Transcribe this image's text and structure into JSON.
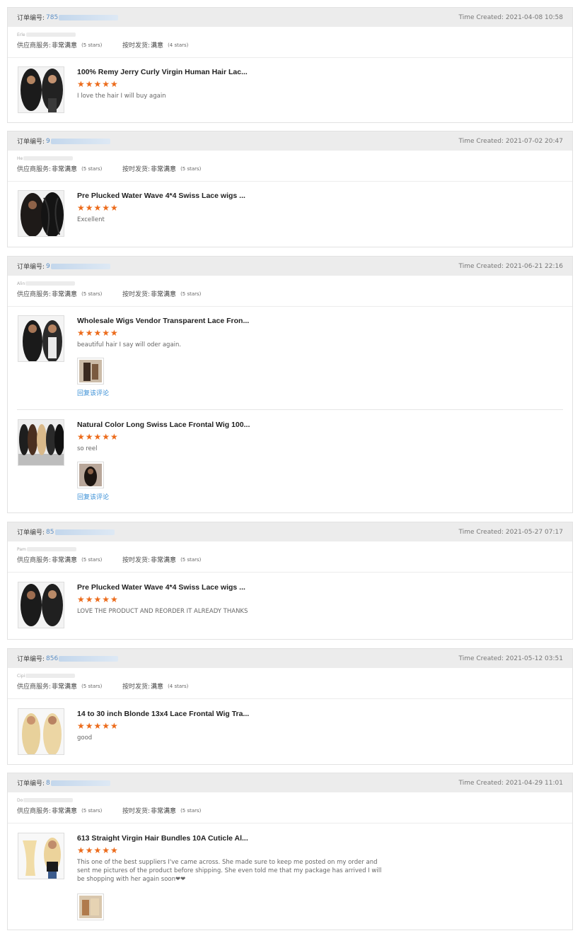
{
  "labels": {
    "order_no": "订单编号:",
    "supplier_service": "供应商服务:",
    "on_time_shipping": "按时发货:",
    "reply": "回复该评论"
  },
  "colors": {
    "star": "#ec6b1b",
    "link": "#3a8fd6",
    "header_bg": "#ececec"
  },
  "orders": [
    {
      "order_prefix": "785",
      "time": "Time Created: 2021-04-08 10:58",
      "buyer": "Erle",
      "service": "非常满意",
      "service_stars": "(5 stars)",
      "shipping": "满意",
      "shipping_stars": "(4 stars)",
      "items": [
        {
          "title": "100% Remy Jerry Curly Virgin Human Hair Lac...",
          "stars": "★★★★★",
          "comment": "I love the hair I will buy again",
          "image": "curly-wig"
        }
      ]
    },
    {
      "order_prefix": "9",
      "time": "Time Created: 2021-07-02 20:47",
      "buyer": "He",
      "service": "非常满意",
      "service_stars": "(5 stars)",
      "shipping": "非常满意",
      "shipping_stars": "(5 stars)",
      "items": [
        {
          "title": "Pre Plucked Water Wave 4*4 Swiss Lace wigs ...",
          "stars": "★★★★★",
          "comment": "Excellent",
          "image": "water-wave-wig"
        }
      ]
    },
    {
      "order_prefix": "9",
      "time": "Time Created: 2021-06-21 22:16",
      "buyer": "Alin",
      "service": "非常满意",
      "service_stars": "(5 stars)",
      "shipping": "非常满意",
      "shipping_stars": "(5 stars)",
      "items": [
        {
          "title": "Wholesale Wigs Vendor Transparent Lace Fron...",
          "stars": "★★★★★",
          "comment": "beautiful hair I say will oder again.",
          "image": "lace-front-wig",
          "photo": "review-photo"
        },
        {
          "title": "Natural Color Long Swiss Lace Frontal Wig 100...",
          "stars": "★★★★★",
          "comment": "so reel",
          "image": "color-wigs",
          "photo": "review-photo"
        }
      ]
    },
    {
      "order_prefix": "85",
      "time": "Time Created: 2021-05-27 07:17",
      "buyer": "Pam",
      "service": "非常满意",
      "service_stars": "(5 stars)",
      "shipping": "非常满意",
      "shipping_stars": "(5 stars)",
      "items": [
        {
          "title": "Pre Plucked Water Wave 4*4 Swiss Lace wigs ...",
          "stars": "★★★★★",
          "comment": "LOVE THE PRODUCT AND REORDER IT ALREADY THANKS",
          "image": "curly-wig"
        }
      ]
    },
    {
      "order_prefix": "856",
      "time": "Time Created: 2021-05-12 03:51",
      "buyer": "Cipi",
      "service": "非常满意",
      "service_stars": "(5 stars)",
      "shipping": "满意",
      "shipping_stars": "(4 stars)",
      "items": [
        {
          "title": "14 to 30 inch Blonde 13x4 Lace Frontal Wig Tra...",
          "stars": "★★★★★",
          "comment": "good",
          "image": "blonde-wig"
        }
      ]
    },
    {
      "order_prefix": "8",
      "time": "Time Created: 2021-04-29 11:01",
      "buyer": "Do",
      "service": "非常满意",
      "service_stars": "(5 stars)",
      "shipping": "非常满意",
      "shipping_stars": "(5 stars)",
      "items": [
        {
          "title": "613 Straight Virgin Hair Bundles 10A Cuticle Al...",
          "stars": "★★★★★",
          "comment": "This one of the best suppliers I've came across. She made sure to keep me posted on my order and sent me pictures of the product before shipping. She even told me that my package has arrived I will be shopping with her again soon❤❤",
          "image": "blonde-bundles",
          "photo": "review-photo"
        }
      ]
    }
  ]
}
